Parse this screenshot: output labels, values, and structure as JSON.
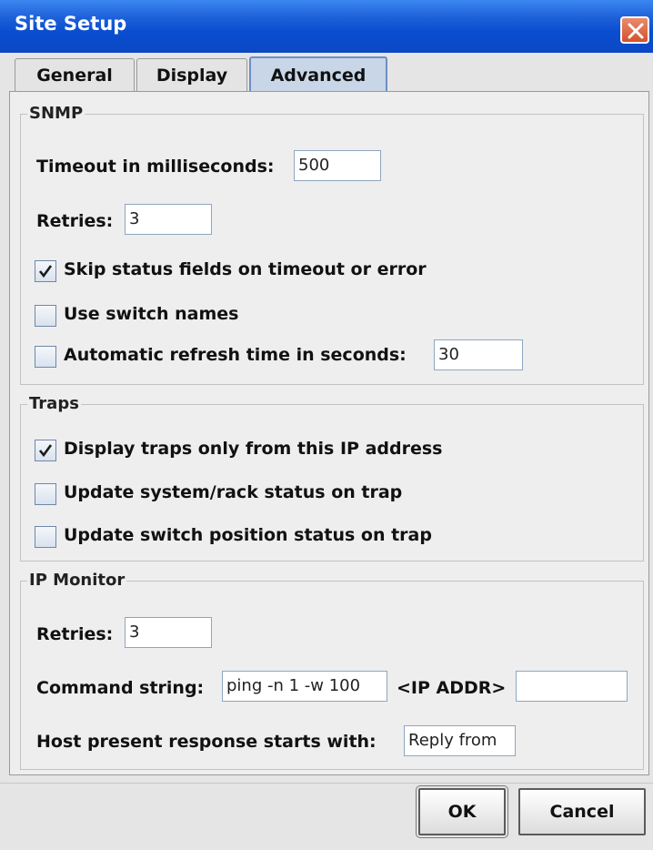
{
  "window": {
    "title": "Site Setup"
  },
  "tabs": [
    {
      "label": "General",
      "active": false
    },
    {
      "label": "Display",
      "active": false
    },
    {
      "label": "Advanced",
      "active": true
    }
  ],
  "snmp": {
    "title": "SNMP",
    "timeout_label": "Timeout in milliseconds:",
    "timeout_value": "500",
    "retries_label": "Retries:",
    "retries_value": "3",
    "skip_status_label": "Skip status fields on timeout or error",
    "skip_status_checked": true,
    "switch_names_label": "Use switch names",
    "switch_names_checked": false,
    "auto_refresh_label": "Automatic refresh time in seconds:",
    "auto_refresh_checked": false,
    "auto_refresh_value": "30"
  },
  "traps": {
    "title": "Traps",
    "display_traps_label": "Display traps only from this IP address",
    "display_traps_checked": true,
    "update_system_label": "Update system/rack status on trap",
    "update_system_checked": false,
    "update_switch_label": "Update switch position status on trap",
    "update_switch_checked": false
  },
  "ip_monitor": {
    "title": "IP Monitor",
    "retries_label": "Retries:",
    "retries_value": "3",
    "command_label": "Command string:",
    "command_value": "ping -n 1 -w 100",
    "ip_addr_label": "<IP ADDR>",
    "ip_addr_suffix_value": "",
    "host_response_label": "Host present response starts with:",
    "host_response_value": "Reply from"
  },
  "buttons": {
    "ok": "OK",
    "cancel": "Cancel"
  },
  "colors": {
    "title_bar": "#0a4ed0",
    "close_button": "#d4512b",
    "active_tab": "#c8d6e8"
  }
}
